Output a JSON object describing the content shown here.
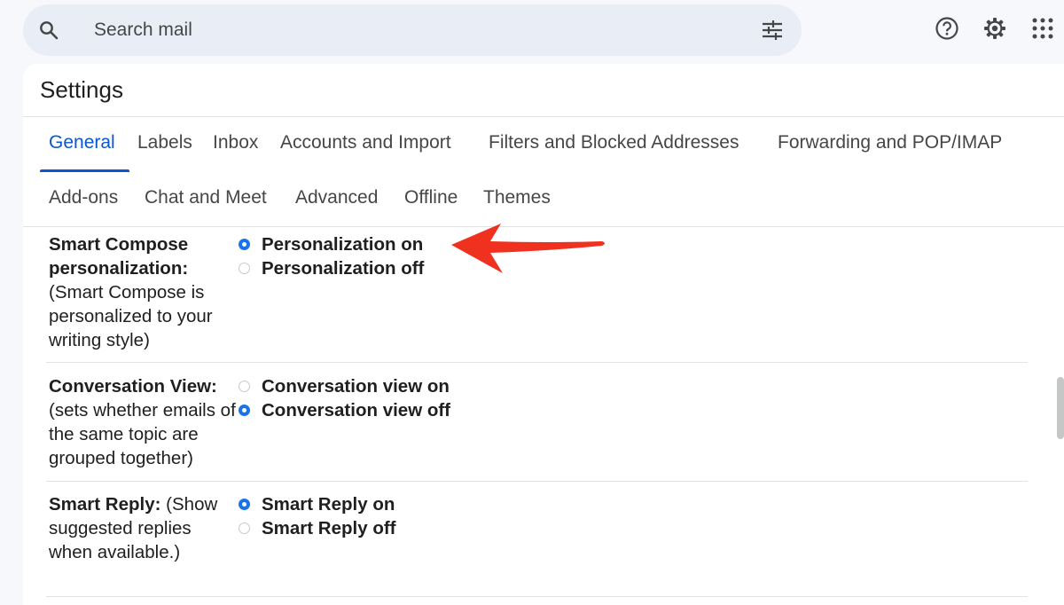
{
  "search": {
    "placeholder": "Search mail"
  },
  "settings_title": "Settings",
  "tabs_row1": [
    "General",
    "Labels",
    "Inbox",
    "Accounts and Import",
    "Filters and Blocked Addresses",
    "Forwarding and POP/IMAP"
  ],
  "tabs_row2": [
    "Add-ons",
    "Chat and Meet",
    "Advanced",
    "Offline",
    "Themes"
  ],
  "active_tab": "General",
  "sections": {
    "smart_compose": {
      "label_bold": "Smart Compose personalization:",
      "label_desc": "(Smart Compose is personalized to your writing style)",
      "options": [
        {
          "label": "Personalization on",
          "selected": true
        },
        {
          "label": "Personalization off",
          "selected": false
        }
      ]
    },
    "conversation_view": {
      "label_bold": "Conversation View:",
      "label_desc": "(sets whether emails of the same topic are grouped together)",
      "options": [
        {
          "label": "Conversation view on",
          "selected": false
        },
        {
          "label": "Conversation view off",
          "selected": true
        }
      ]
    },
    "smart_reply": {
      "label_bold": "Smart Reply:",
      "label_desc": "(Show suggested replies when available.)",
      "options": [
        {
          "label": "Smart Reply on",
          "selected": true
        },
        {
          "label": "Smart Reply off",
          "selected": false
        }
      ]
    }
  },
  "colors": {
    "accent": "#0b57d0",
    "radio_selected": "#1a73e8",
    "annotation_arrow": "#f0311f"
  },
  "icons": [
    "search-icon",
    "filter-options-icon",
    "help-icon",
    "settings-gear-icon",
    "apps-grid-icon",
    "annotation-arrow"
  ]
}
